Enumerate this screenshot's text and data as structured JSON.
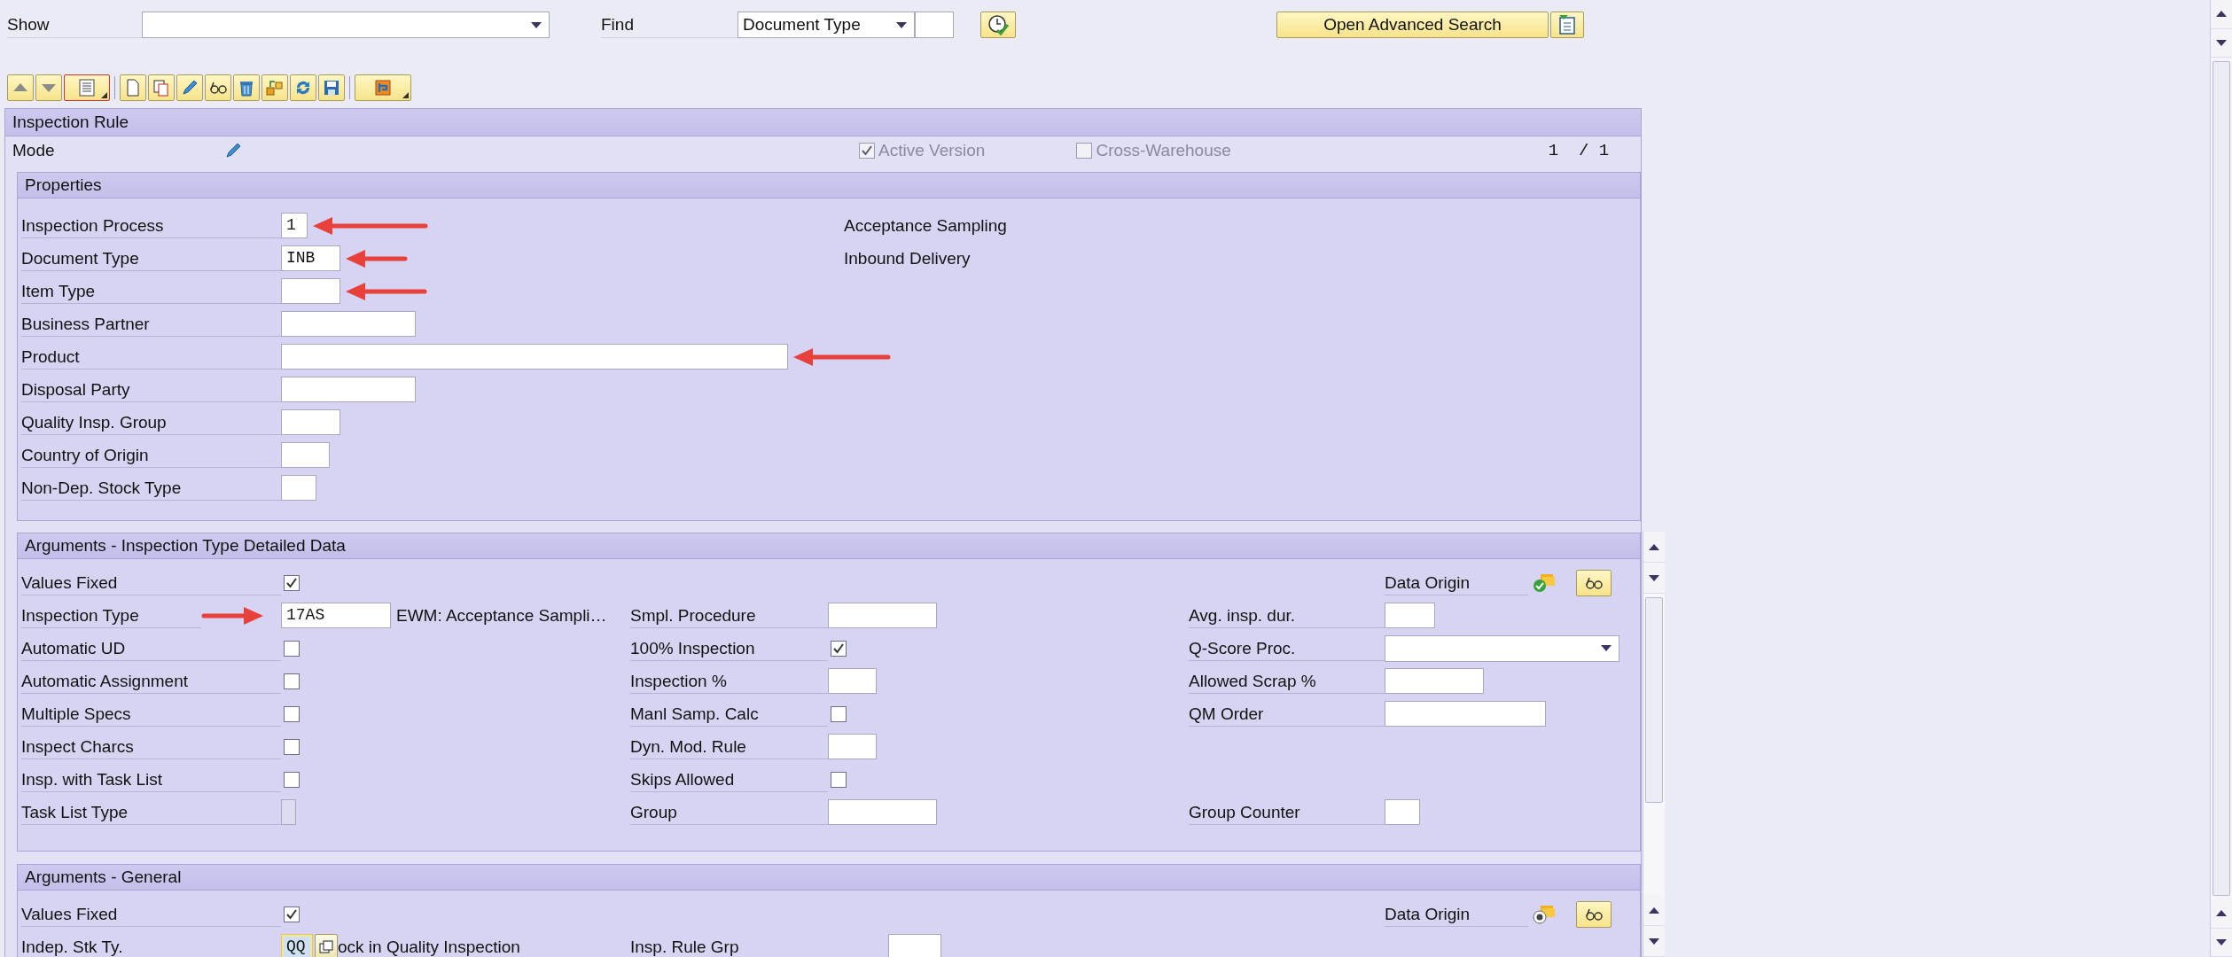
{
  "top_bar": {
    "show": {
      "label": "Show"
    },
    "find": {
      "label": "Find",
      "value": "Document Type"
    },
    "advanced_search": "Open Advanced Search"
  },
  "toolbar": [
    {
      "kind": "up"
    },
    {
      "kind": "down"
    },
    {
      "kind": "list"
    },
    {
      "kind": "new"
    },
    {
      "kind": "copy"
    },
    {
      "kind": "edit"
    },
    {
      "kind": "display"
    },
    {
      "kind": "delete"
    },
    {
      "kind": "transport"
    },
    {
      "kind": "refresh"
    },
    {
      "kind": "save"
    },
    {
      "kind": "layout"
    }
  ],
  "inspection_rule": {
    "title": "Inspection Rule",
    "mode": "Mode",
    "active_version": {
      "label": "Active Version",
      "checked": true
    },
    "cross_warehouse": {
      "label": "Cross-Warehouse",
      "checked": false
    },
    "pager": "1  / 1"
  },
  "properties": {
    "title": "Properties",
    "rows": [
      {
        "label": "Inspection Process",
        "value": "1",
        "description": "Acceptance Sampling",
        "arrow": true
      },
      {
        "label": "Document Type",
        "value": "INB",
        "description": "Inbound Delivery",
        "arrow": true
      },
      {
        "label": "Item Type",
        "arrow": true
      },
      {
        "label": "Business Partner"
      },
      {
        "label": "Product",
        "arrow": true
      },
      {
        "label": "Disposal Party"
      },
      {
        "label": "Quality Insp. Group"
      },
      {
        "label": "Country of Origin"
      },
      {
        "label": "Non-Dep. Stock Type"
      }
    ]
  },
  "sections": [
    {
      "title": "Arguments - Inspection Type Detailed Data",
      "rows": [
        {
          "left": {
            "label": "Values Fixed",
            "kind": "checkbox",
            "checked": true
          },
          "right": {
            "label": "Data Origin",
            "kind": "origin",
            "verified": true
          }
        },
        {
          "left": {
            "label": "Inspection Type",
            "kind": "input",
            "value": "17AS",
            "description": "EWM: Acceptance Sampli…",
            "arrow": true
          },
          "middle": {
            "label": "Smpl. Procedure",
            "kind": "input"
          },
          "right": {
            "label": "Avg. insp. dur.",
            "kind": "input"
          }
        },
        {
          "left": {
            "label": "Automatic UD",
            "kind": "checkbox",
            "checked": false
          },
          "middle": {
            "label": "100% Inspection",
            "kind": "checkbox",
            "checked": true
          },
          "right": {
            "label": "Q-Score Proc.",
            "kind": "dropdown"
          }
        },
        {
          "left": {
            "label": "Automatic Assignment",
            "kind": "checkbox",
            "checked": false
          },
          "middle": {
            "label": "Inspection %",
            "kind": "input"
          },
          "right": {
            "label": "Allowed Scrap %",
            "kind": "input"
          }
        },
        {
          "left": {
            "label": "Multiple Specs",
            "kind": "checkbox",
            "checked": false
          },
          "middle": {
            "label": "Manl Samp. Calc",
            "kind": "checkbox",
            "checked": false
          },
          "right": {
            "label": "QM Order",
            "kind": "input"
          }
        },
        {
          "left": {
            "label": "Inspect Charcs",
            "kind": "checkbox",
            "checked": false
          },
          "middle": {
            "label": "Dyn. Mod. Rule",
            "kind": "input"
          }
        },
        {
          "left": {
            "label": "Insp. with Task List",
            "kind": "checkbox",
            "checked": false
          },
          "middle": {
            "label": "Skips Allowed",
            "kind": "checkbox",
            "checked": false
          }
        },
        {
          "left": {
            "label": "Task List Type",
            "kind": "locked"
          },
          "middle": {
            "label": "Group",
            "kind": "input"
          },
          "right": {
            "label": "Group Counter",
            "kind": "input"
          }
        }
      ]
    },
    {
      "title": "Arguments - General",
      "rows": [
        {
          "left": {
            "label": "Values Fixed",
            "kind": "checkbox",
            "checked": true
          },
          "right": {
            "label": "Data Origin",
            "kind": "origin",
            "verified": false
          }
        },
        {
          "left": {
            "label": "Indep. Stk Ty.",
            "kind": "value-help",
            "value": "QQ",
            "description": "ock in Quality Inspection"
          },
          "middle": {
            "label": "Insp. Rule Grp",
            "kind": "input"
          }
        }
      ]
    }
  ]
}
